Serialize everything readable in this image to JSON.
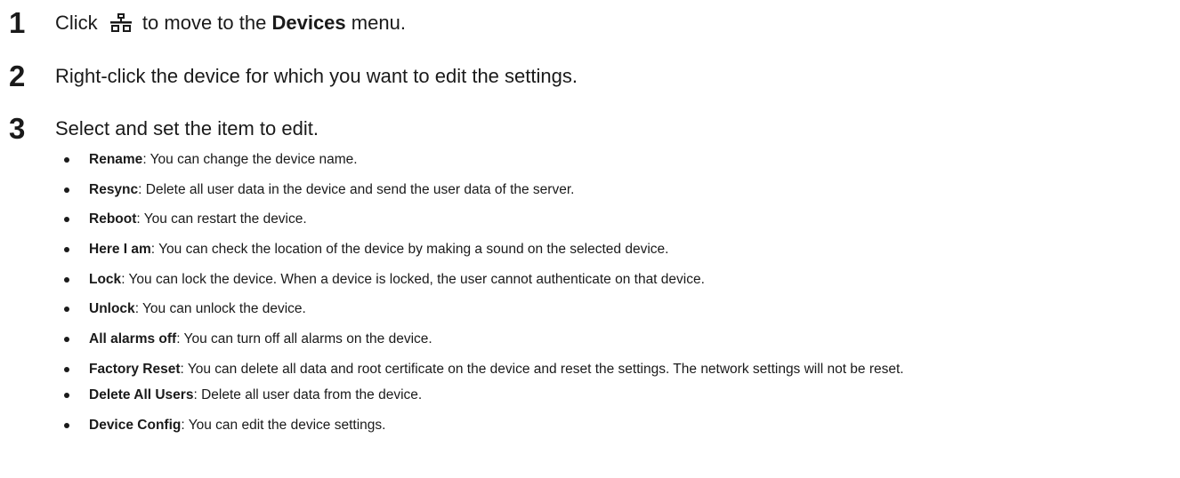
{
  "steps": [
    {
      "number": "1",
      "text_before": "Click",
      "icon": "network-devices-icon",
      "text_middle": "to move to the",
      "bold": "Devices",
      "text_after": "menu."
    },
    {
      "number": "2",
      "text": "Right-click the device for which you want to edit the settings."
    },
    {
      "number": "3",
      "text": "Select and set the item to edit.",
      "items": [
        {
          "term": "Rename",
          "desc": ": You can change the device name."
        },
        {
          "term": "Resync",
          "desc": ": Delete all user data in the device and send the user data of the server."
        },
        {
          "term": "Reboot",
          "desc": ": You can restart the device."
        },
        {
          "term": "Here I am",
          "desc": ": You can check the location of the device by making a sound on the selected device."
        },
        {
          "term": "Lock",
          "desc": ": You can lock the device. When a device is locked, the user cannot authenticate on that device."
        },
        {
          "term": "Unlock",
          "desc": ": You can unlock the device."
        },
        {
          "term": "All alarms off",
          "desc": ": You can turn off all alarms on the device."
        },
        {
          "term": "Factory Reset",
          "desc": ": You can delete all data and root certificate on the device and reset the settings. The network settings will not be reset."
        },
        {
          "term": "Delete All Users",
          "desc": ": Delete all user data from the device."
        },
        {
          "term": "Device Config",
          "desc": ": You can edit the device settings."
        }
      ]
    }
  ]
}
